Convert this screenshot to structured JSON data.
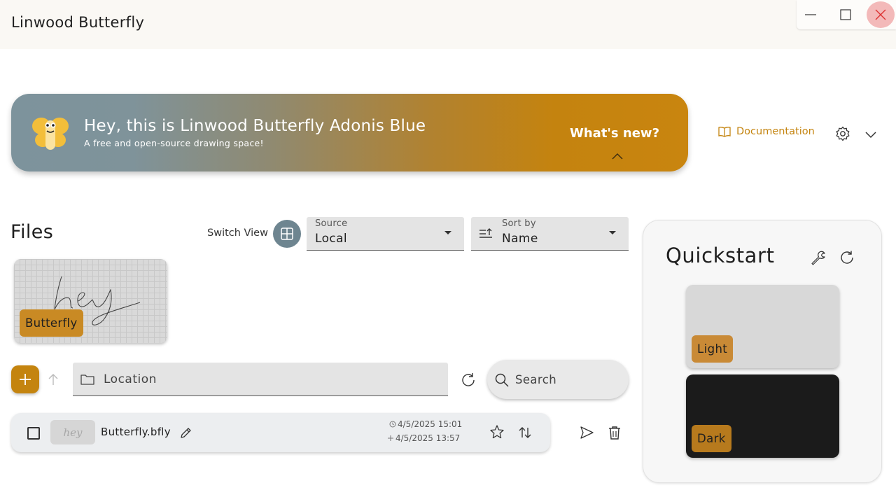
{
  "window": {
    "title": "Linwood Butterfly",
    "controls": [
      "minimize-icon",
      "maximize-icon",
      "close-icon"
    ]
  },
  "banner": {
    "title": "Hey, this is Linwood Butterfly Adonis Blue",
    "subtitle": "A free and open-source drawing space!",
    "whats_new": "What's new?",
    "logo": "butterfly-logo"
  },
  "header_actions": {
    "documentation": "Documentation",
    "settings_icon": "gear-icon",
    "expand_icon": "chevron-down-icon"
  },
  "files": {
    "heading": "Files",
    "switch_view_label": "Switch View",
    "source": {
      "label": "Source",
      "value": "Local"
    },
    "sort": {
      "label": "Sort by",
      "value": "Name"
    },
    "grid_items": [
      {
        "label": "Butterfly",
        "preview_text": "hey"
      }
    ],
    "location_placeholder": "Location",
    "search_placeholder": "Search",
    "list_items": [
      {
        "name": "Butterfly.bfly",
        "thumb_text": "hey",
        "modified": "4/5/2025 15:01",
        "created": "4/5/2025 13:57"
      }
    ]
  },
  "quickstart": {
    "title": "Quickstart",
    "themes": [
      {
        "label": "Light"
      },
      {
        "label": "Dark"
      }
    ]
  },
  "colors": {
    "accent": "#c4840f",
    "banner_start": "#7d939c",
    "banner_end": "#c9850f",
    "switch_view": "#6e8590"
  }
}
